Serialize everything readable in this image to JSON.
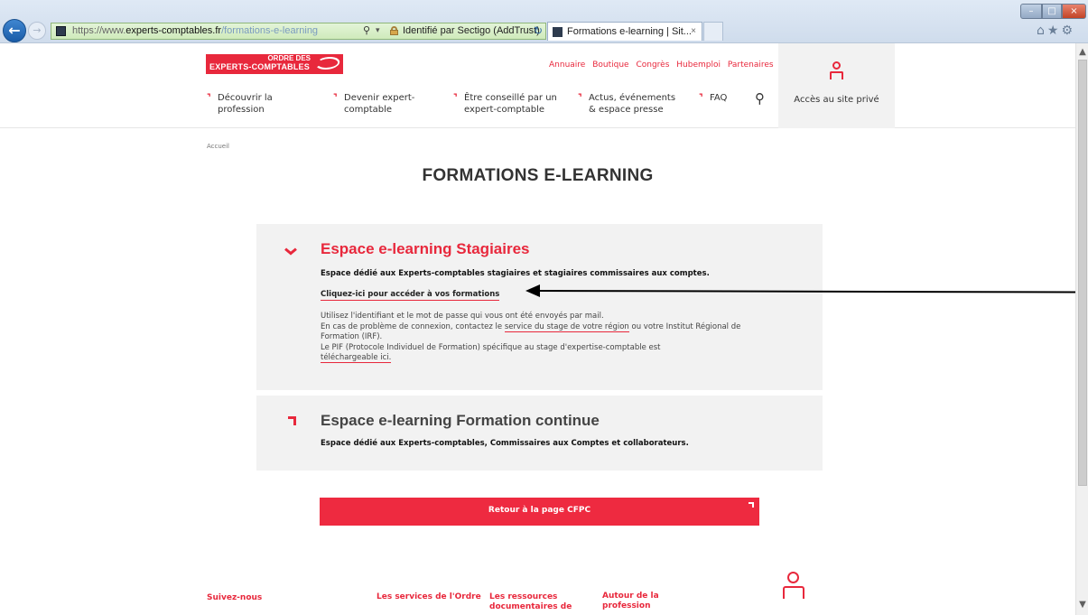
{
  "browser": {
    "url_scheme": "https://www.",
    "url_host": "experts-comptables.fr",
    "url_path": "/formations-e-learning",
    "identity": "Identifié par Sectigo (AddTrust)",
    "tab_title": "Formations e-learning | Sit...",
    "tab_close": "×",
    "search_glyph": "⚲",
    "dropdown_glyph": "▾",
    "refresh_glyph": "↻",
    "back_glyph": "←",
    "forward_glyph": "→",
    "toolbar_icons": "⌂★⚙",
    "window": {
      "min": "–",
      "max": "□",
      "close": "×"
    }
  },
  "site": {
    "logo": {
      "line1": "ORDRE DES",
      "line2": "EXPERTS-COMPTABLES"
    },
    "top_links": [
      "Annuaire",
      "Boutique",
      "Congrès",
      "Hubemploi",
      "Partenaires"
    ],
    "nav": [
      {
        "mark": "⌝",
        "line1": "Découvrir la",
        "line2": "profession"
      },
      {
        "mark": "⌝",
        "line1": "Devenir expert-",
        "line2": "comptable"
      },
      {
        "mark": "⌝",
        "line1": "Être conseillé par un",
        "line2": "expert-comptable"
      },
      {
        "mark": "⌝",
        "line1": "Actus, événements",
        "line2": "& espace presse"
      },
      {
        "mark": "⌝",
        "line1": "FAQ",
        "line2": ""
      }
    ],
    "search_icon": "⚲",
    "private_access": "Accès au site privé",
    "brand_color": "#e8283c"
  },
  "page": {
    "breadcrumb": "Accueil",
    "title": "FORMATIONS E-LEARNING",
    "panel1": {
      "heading": "Espace e-learning Stagiaires",
      "subtitle": "Espace dédié aux Experts-comptables stagiaires et stagiaires commissaires aux comptes.",
      "access_link": "Cliquez-ici pour accéder à vos formations",
      "p1": "Utilisez l'identifiant et le mot de passe qui vous ont été envoyés par mail.",
      "p2_before": "En cas de problème de connexion, contactez le ",
      "p2_link": "service du stage de votre région",
      "p2_after": " ou votre Institut Régional de Formation (IRF).",
      "p3": "Le PIF (Protocole Individuel de Formation) spécifique au stage d'expertise-comptable est",
      "p3_link": "téléchargeable ici."
    },
    "panel2": {
      "heading": "Espace e-learning Formation continue",
      "subtitle": "Espace dédié aux Experts-comptables, Commissaires aux Comptes et collaborateurs."
    },
    "cta": "Retour à la page CFPC"
  },
  "footer": {
    "follow": "Suivez-nous",
    "services": "Les services de l'Ordre",
    "resources_1": "Les ressources",
    "resources_2": "documentaires de",
    "about_1": "Autour de la",
    "about_2": "profession"
  },
  "scrollbar": {
    "up": "▲",
    "down": "▼"
  }
}
